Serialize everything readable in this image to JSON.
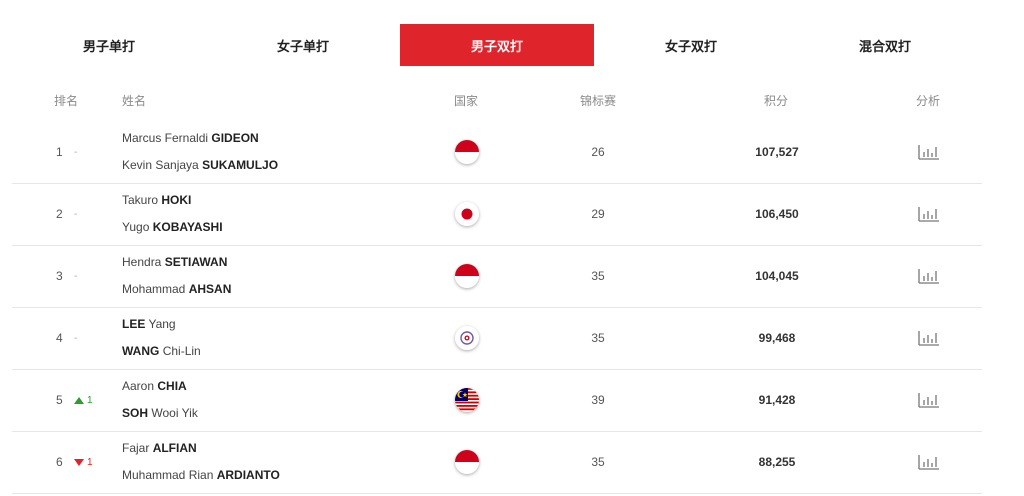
{
  "tabs": [
    {
      "label": "男子单打",
      "active": false
    },
    {
      "label": "女子单打",
      "active": false
    },
    {
      "label": "男子双打",
      "active": true
    },
    {
      "label": "女子双打",
      "active": false
    },
    {
      "label": "混合双打",
      "active": false
    }
  ],
  "header": {
    "rank": "排名",
    "name": "姓名",
    "country": "国家",
    "tournaments": "锦标赛",
    "points": "积分",
    "analysis": "分析"
  },
  "colors": {
    "accent": "#e0242b",
    "up": "#2e9c2e",
    "down": "#e0242b"
  },
  "rows": [
    {
      "rank": "1",
      "change": "-",
      "change_dir": "same",
      "p1_first": "Marcus Fernaldi",
      "p1_last": "GIDEON",
      "p2_first": "Kevin Sanjaya",
      "p2_last": "SUKAMULJO",
      "flag": "indonesia-flag",
      "tournaments": "26",
      "points": "107,527"
    },
    {
      "rank": "2",
      "change": "-",
      "change_dir": "same",
      "p1_first": "Takuro",
      "p1_last": "HOKI",
      "p2_first": "Yugo",
      "p2_last": "KOBAYASHI",
      "flag": "japan-flag",
      "tournaments": "29",
      "points": "106,450"
    },
    {
      "rank": "3",
      "change": "-",
      "change_dir": "same",
      "p1_first": "Hendra",
      "p1_last": "SETIAWAN",
      "p2_first": "Mohammad",
      "p2_last": "AHSAN",
      "flag": "indonesia-flag",
      "tournaments": "35",
      "points": "104,045"
    },
    {
      "rank": "4",
      "change": "-",
      "change_dir": "same",
      "p1_first": "Yang",
      "p1_last": "LEE",
      "p2_first": "Chi-Lin",
      "p2_last": "WANG",
      "family_first": true,
      "flag": "chinese-taipei-flag",
      "tournaments": "35",
      "points": "99,468"
    },
    {
      "rank": "5",
      "change": "1",
      "change_dir": "up",
      "p1_first": "Aaron",
      "p1_last": "CHIA",
      "p2_first": "Wooi Yik",
      "p2_last": "SOH",
      "p2_family_first": true,
      "flag": "malaysia-flag",
      "tournaments": "39",
      "points": "91,428"
    },
    {
      "rank": "6",
      "change": "1",
      "change_dir": "down",
      "p1_first": "Fajar",
      "p1_last": "ALFIAN",
      "p2_first": "Muhammad Rian",
      "p2_last": "ARDIANTO",
      "flag": "indonesia-flag",
      "tournaments": "35",
      "points": "88,255"
    }
  ]
}
